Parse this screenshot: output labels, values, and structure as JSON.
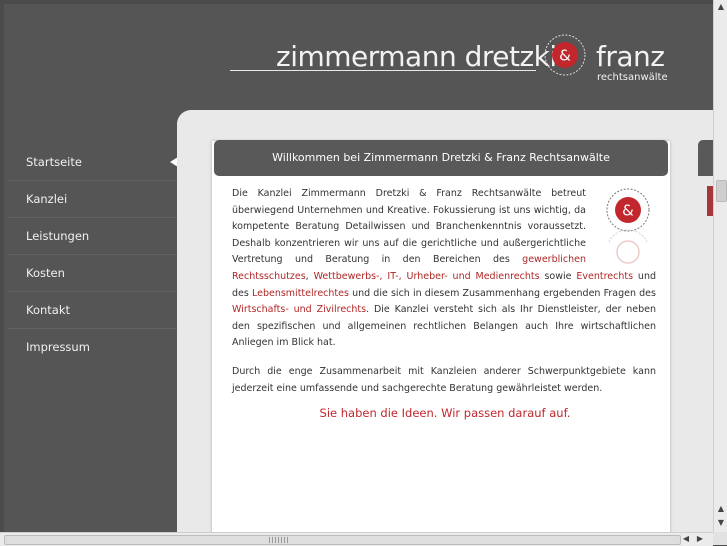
{
  "header": {
    "brand_main": "zimmermann dretzki",
    "brand_end": "franz",
    "brand_sub": "rechtsanwälte",
    "seal_symbol": "&"
  },
  "nav": {
    "items": [
      {
        "label": "Startseite",
        "active": true
      },
      {
        "label": "Kanzlei"
      },
      {
        "label": "Leistungen"
      },
      {
        "label": "Kosten"
      },
      {
        "label": "Kontakt"
      },
      {
        "label": "Impressum"
      }
    ]
  },
  "content": {
    "title": "Willkommen bei Zimmermann Dretzki & Franz Rechtsanwälte",
    "p1": {
      "t1": "Die Kanzlei Zimmermann Dretzki & Franz Rechtsanwälte betreut überwiegend Unternehmen und Kreative. Fokussierung ist uns wichtig, da kompetente Beratung Detailwissen und Branchenkenntnis voraussetzt. Deshalb konzentrieren wir uns auf die gerichtliche und außergerichtliche Vertretung und Beratung in den Bereichen des ",
      "l1": "gewerblichen Rechtsschutzes",
      "t2": ", ",
      "l2": "Wettbewerbs-, IT-, Urheber- und Medienrechts",
      "t3": " sowie ",
      "l3": "Eventrechts",
      "t4": " und des ",
      "l4": "Lebensmittelrechtes",
      "t5": " und die sich in diesem Zusammenhang ergebenden Fragen des ",
      "l5": "Wirtschafts- und Zivilrechts",
      "t6": ". Die Kanzlei versteht sich als Ihr Dienstleister, der neben den spezifischen und allgemeinen rechtlichen Belangen auch Ihre wirtschaftlichen Anliegen im Blick hat."
    },
    "p2": "Durch die enge Zusammenarbeit mit Kanzleien anderer Schwerpunktgebiete kann jederzeit eine umfassende und sachgerechte Beratung gewährleistet werden.",
    "slogan": "Sie haben die Ideen. Wir passen darauf auf.",
    "seal_symbol": "&"
  },
  "colors": {
    "accent": "#c1272d",
    "link": "#b02727",
    "dark": "#555555"
  }
}
